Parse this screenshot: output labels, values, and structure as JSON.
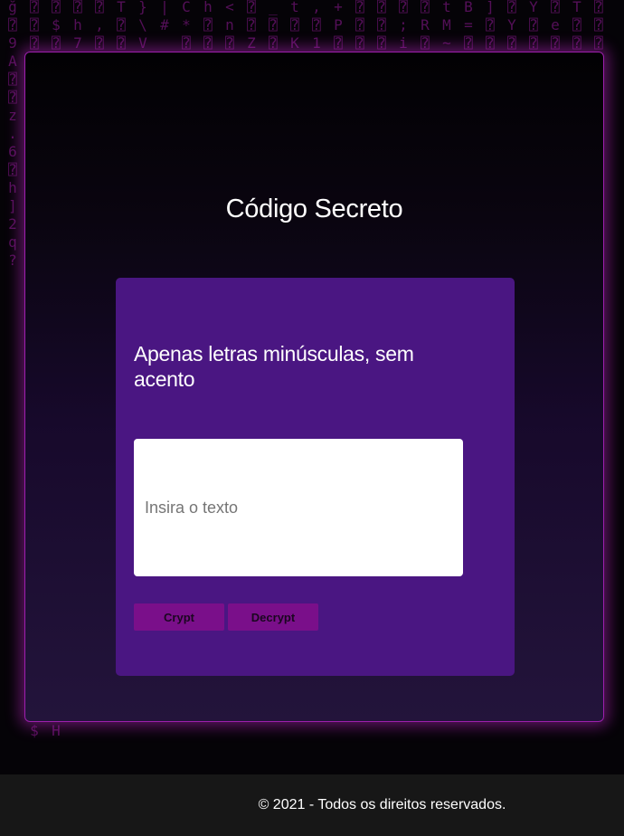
{
  "page": {
    "title": "Código Secreto"
  },
  "card": {
    "heading": "Apenas letras minúsculas, sem acento",
    "input_placeholder": "Insira o texto",
    "input_value": "",
    "crypt_label": "Crypt",
    "decrypt_label": "Decrypt"
  },
  "footer": {
    "text": "© 2021 - Todos os direitos reservados."
  },
  "background": {
    "matrix_columns": [
      "ğ⍰9A⍰⍰z.6⍰h]2q?",
      "⍰⍰⍰⍰⍰⍰⍰⍰⍰⍰⍰⍰⍰⍰⍰⍰⍰⍰⍰⍰⍰⍰⍰⍰⍰⍰⍰⍰⍰⍰⍰⍰⍰⍰⍰⍰⍰⍰⍰k$",
      "⍰$⍰⍰⍰⍰⍰⍰⍰⍰⍰⍰⍰⍰⍰⍰⍰⍰⍰⍰⍰⍰⍰⍰⍰⍰⍰⍰⍰⍰⍰⍰⍰⍰⍰⍰⍰⍰⍰⍰H",
      "⍰h7",
      "⍰,⍰",
      "T⍰⍰",
      "}\\V",
      "|#",
      "C*⍰",
      "h⍰⍰",
      "<n⍰",
      "⍰⍰Z",
      "_⍰⍰",
      "t⍰K",
      ",⍰1",
      "+P⍰",
      "⍰⍰⍰",
      "⍰⍰⍰",
      "⍰;i",
      "⍰R⍰",
      "tM~",
      "B=⍰",
      "]⍰⍰",
      "⍰Y⍰",
      "Y⍰⍰",
      "⍰e⍰",
      "T⍰⍰",
      "⍰⍰⍰"
    ]
  },
  "colors": {
    "accent": "#b21fb8",
    "card": "#4a1682",
    "button": "#7a0f8a",
    "footer": "#171717"
  }
}
